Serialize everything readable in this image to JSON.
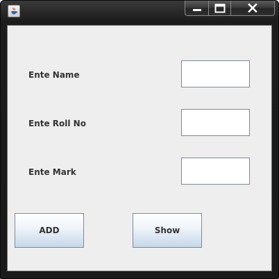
{
  "window": {
    "title": "",
    "controls": {
      "minimize": "minimize",
      "maximize": "maximize",
      "close": "close"
    }
  },
  "form": {
    "name_label": "Ente Name",
    "name_value": "",
    "roll_label": "Ente Roll No",
    "roll_value": "",
    "mark_label": "Ente Mark",
    "mark_value": ""
  },
  "buttons": {
    "add_label": "ADD",
    "show_label": "Show"
  },
  "icons": {
    "app": "java-cup-icon",
    "minimize": "minimize-icon",
    "maximize": "maximize-icon",
    "close": "close-icon"
  }
}
